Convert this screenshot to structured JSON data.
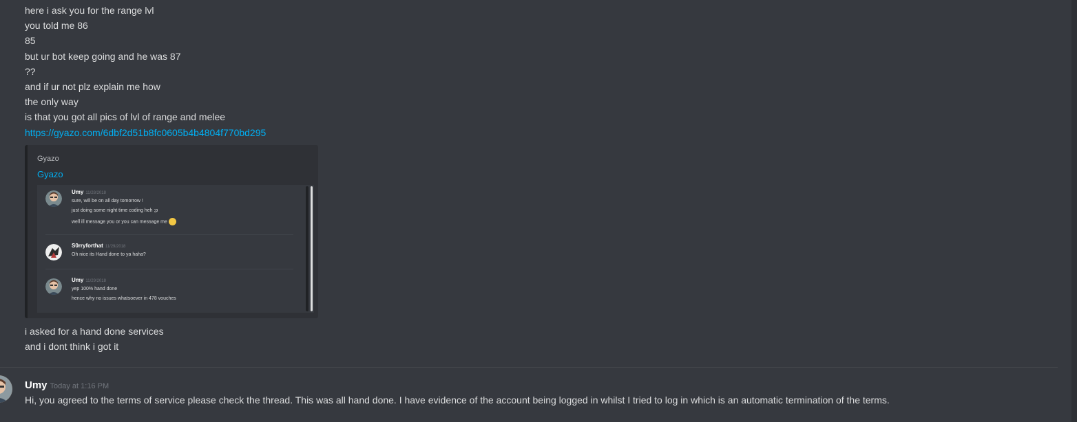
{
  "messages_top": [
    {
      "text": "here i ask you for the range lvl"
    },
    {
      "text": "you told me 86"
    },
    {
      "text": "85"
    },
    {
      "text": "but ur bot keep going and he was 87"
    },
    {
      "text": "??"
    },
    {
      "text": "and if ur not plz explain me how"
    },
    {
      "text": "the only way"
    },
    {
      "text": "is that you got all pics of lvl of range and melee"
    }
  ],
  "link": "https://gyazo.com/6dbf2d51b8fc0605b4b4804f770bd295",
  "embed": {
    "provider": "Gyazo",
    "title": "Gyazo",
    "image_messages": [
      {
        "author": "Umy",
        "date": "11/28/2018",
        "lines": [
          "sure, will be on all day tomorrow !",
          "just doing some night time coding heh ;p",
          "well ill message you or you can message me"
        ]
      },
      {
        "author": "S0rryforthat",
        "date": "11/29/2018",
        "lines": [
          "Oh nice its Hand done to ya haha?"
        ]
      },
      {
        "author": "Umy",
        "date": "11/29/2018",
        "lines": [
          "yep 100% hand done",
          "hence why no issues whatsoever in 478 vouches"
        ]
      }
    ]
  },
  "messages_bottom": [
    {
      "text": "i asked for a hand done services"
    },
    {
      "text": "and i dont think i got it"
    }
  ],
  "reply": {
    "author": "Umy",
    "timestamp": "Today at 1:16 PM",
    "text": "Hi, you agreed to the terms of service please check the thread. This was all hand done. I have evidence of the account being logged in whilst I tried to log in which is an automatic termination of the terms."
  },
  "colors": {
    "background": "#36393f",
    "text": "#dcddde",
    "link": "#00b0f4",
    "author": "#ffffff",
    "timestamp": "#72767d"
  }
}
